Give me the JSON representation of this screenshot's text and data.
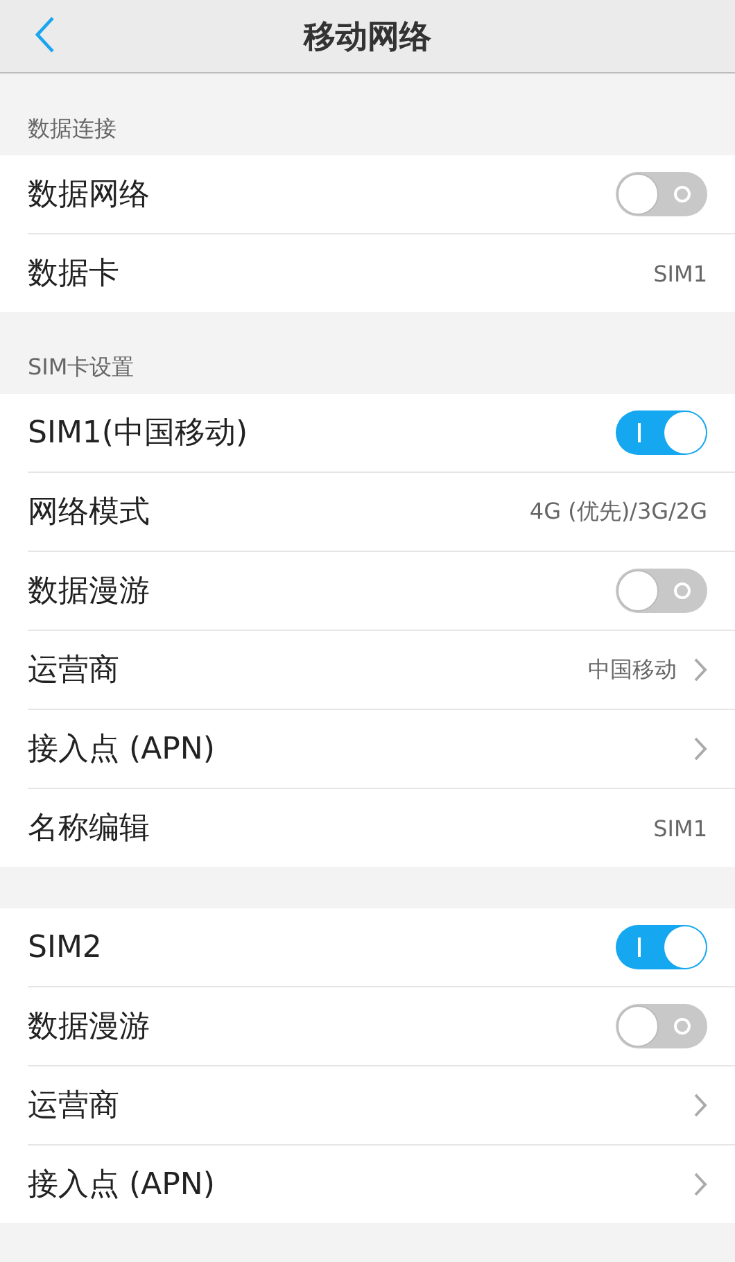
{
  "header": {
    "title": "移动网络"
  },
  "sections": [
    {
      "title": "数据连接",
      "items": [
        {
          "kind": "toggle",
          "label": "数据网络",
          "on": false
        },
        {
          "kind": "value",
          "label": "数据卡",
          "value": "SIM1"
        }
      ]
    },
    {
      "title": "SIM卡设置",
      "items": [
        {
          "kind": "toggle",
          "label": "SIM1(中国移动)",
          "on": true
        },
        {
          "kind": "value",
          "label": "网络模式",
          "value": "4G (优先)/3G/2G"
        },
        {
          "kind": "toggle",
          "label": "数据漫游",
          "on": false
        },
        {
          "kind": "link",
          "label": "运营商",
          "value": "中国移动"
        },
        {
          "kind": "link",
          "label": "接入点 (APN)"
        },
        {
          "kind": "value",
          "label": "名称编辑",
          "value": "SIM1"
        }
      ]
    },
    {
      "items": [
        {
          "kind": "toggle",
          "label": "SIM2",
          "on": true
        },
        {
          "kind": "toggle",
          "label": "数据漫游",
          "on": false
        },
        {
          "kind": "link",
          "label": "运营商"
        },
        {
          "kind": "link",
          "label": "接入点 (APN)"
        }
      ]
    }
  ]
}
